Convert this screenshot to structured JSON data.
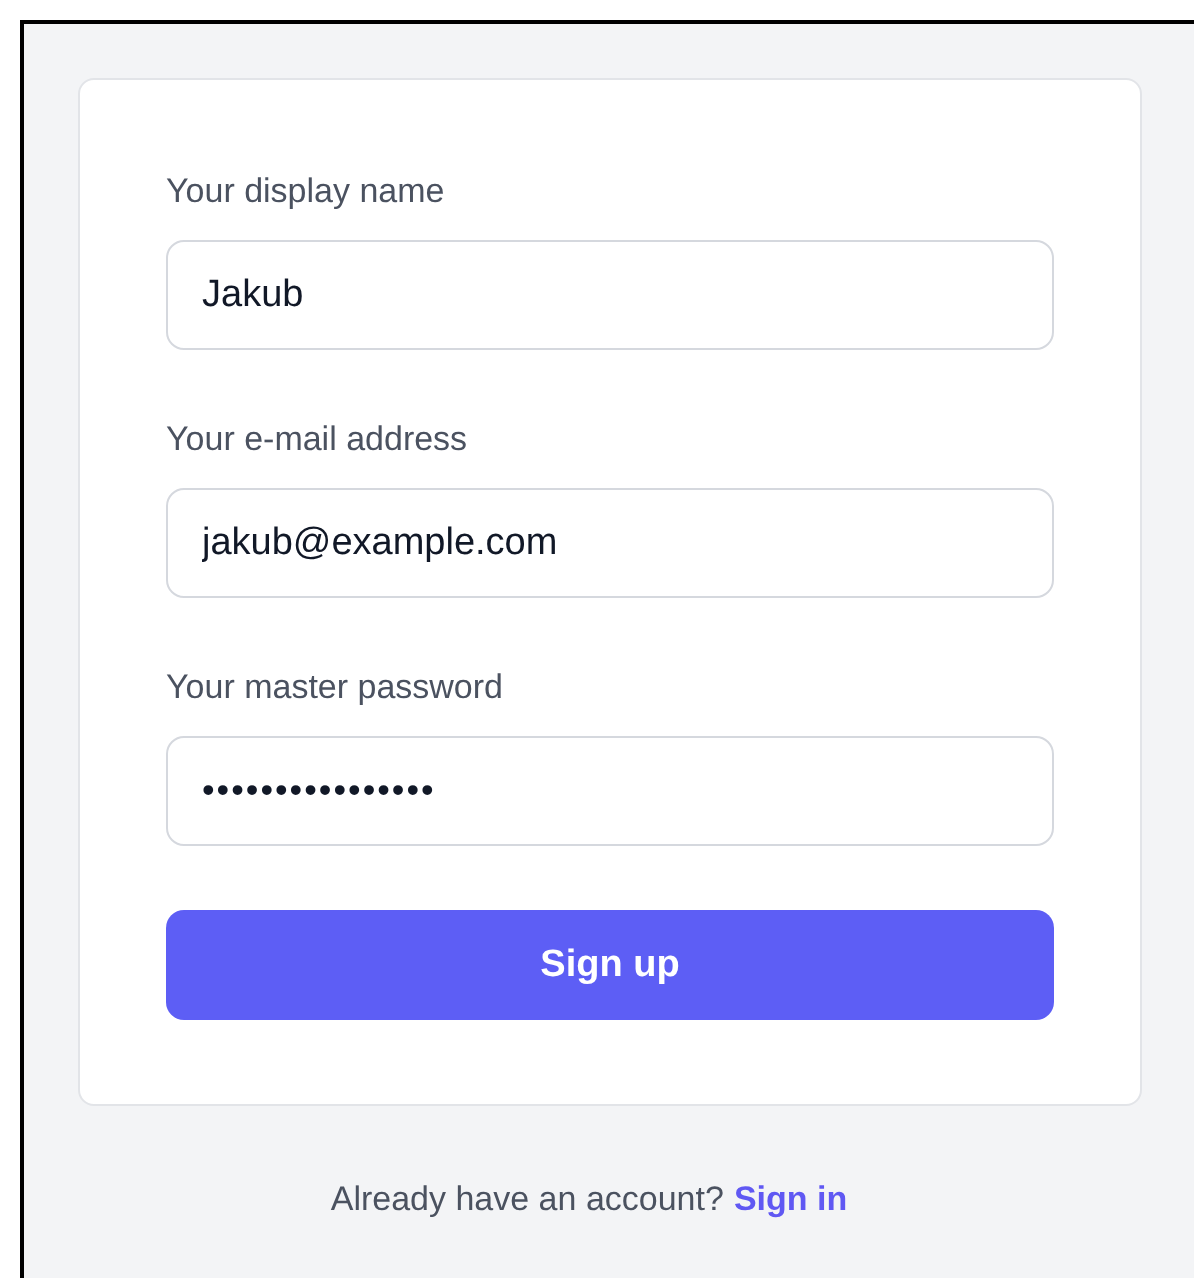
{
  "fields": [
    {
      "label": "Your display name",
      "value": "Jakub"
    },
    {
      "label": "Your e-mail address",
      "value": "jakub@example.com"
    },
    {
      "label": "Your master password",
      "value": "••••••••••••••••"
    }
  ],
  "submit_button": "Sign up",
  "footer": {
    "text": "Already have an account?",
    "link": "Sign in"
  }
}
